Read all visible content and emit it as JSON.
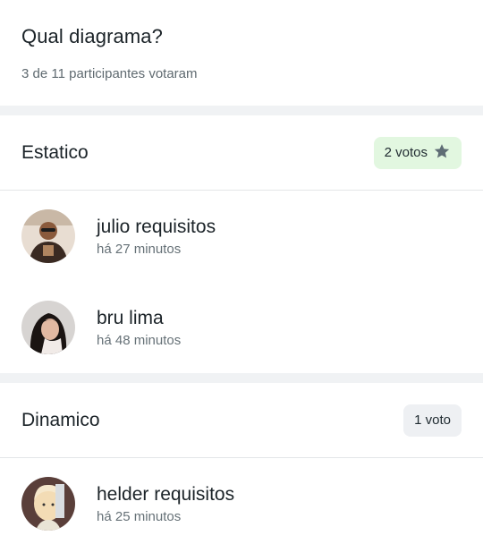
{
  "poll": {
    "question": "Qual diagrama?",
    "summary": "3 de 11 participantes votaram"
  },
  "options": [
    {
      "title": "Estatico",
      "votes_label": "2 votos",
      "winner": true,
      "voters": [
        {
          "name": "julio requisitos",
          "time": "há 27 minutos",
          "avatar": "photo-man-sunglasses"
        },
        {
          "name": "bru lima",
          "time": "há 48 minutos",
          "avatar": "photo-woman-dark-hair"
        }
      ]
    },
    {
      "title": "Dinamico",
      "votes_label": "1 voto",
      "winner": false,
      "voters": [
        {
          "name": "helder requisitos",
          "time": "há 25 minutos",
          "avatar": "anime-bald-character"
        }
      ]
    }
  ],
  "icons": {
    "winner": "star-icon"
  },
  "colors": {
    "winner_badge_bg": "#e2f7e0",
    "normal_badge_bg": "#eef0f3",
    "star": "#5f6d75"
  }
}
